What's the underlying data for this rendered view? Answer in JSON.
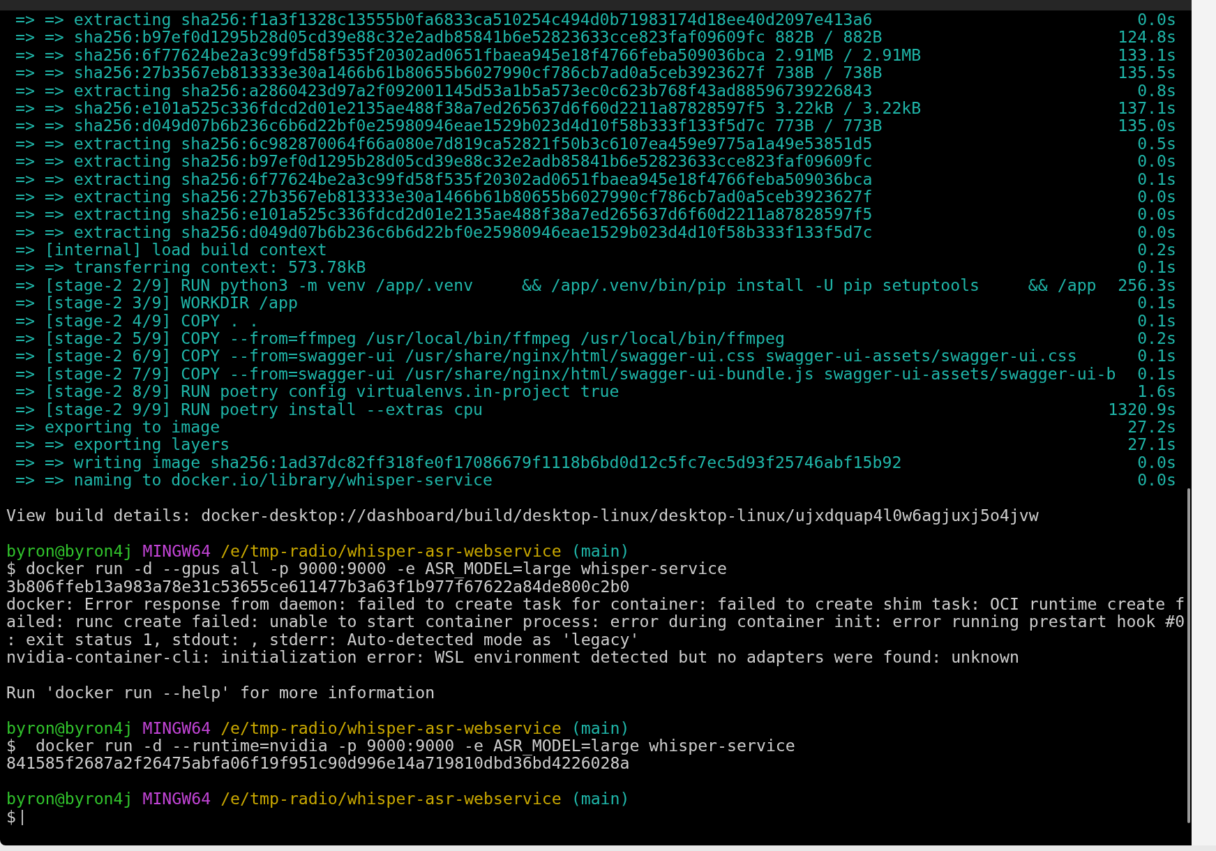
{
  "build_lines": [
    {
      "text": "=> => extracting sha256:f1a3f1328c13555b0fa6833ca510254c494d0b71983174d18ee40d2097e413a6",
      "time": "0.0s"
    },
    {
      "text": "=> => sha256:b97ef0d1295b28d05cd39e88c32e2adb85841b6e52823633cce823faf09609fc 882B / 882B",
      "time": "124.8s"
    },
    {
      "text": "=> => sha256:6f77624be2a3c99fd58f535f20302ad0651fbaea945e18f4766feba509036bca 2.91MB / 2.91MB",
      "time": "133.1s"
    },
    {
      "text": "=> => sha256:27b3567eb813333e30a1466b61b80655b6027990cf786cb7ad0a5ceb3923627f 738B / 738B",
      "time": "135.5s"
    },
    {
      "text": "=> => extracting sha256:a2860423d97a2f092001145d53a1b5a573ec0c623b768f43ad88596739226843",
      "time": "0.8s"
    },
    {
      "text": "=> => sha256:e101a525c336fdcd2d01e2135ae488f38a7ed265637d6f60d2211a87828597f5 3.22kB / 3.22kB",
      "time": "137.1s"
    },
    {
      "text": "=> => sha256:d049d07b6b236c6b6d22bf0e25980946eae1529b023d4d10f58b333f133f5d7c 773B / 773B",
      "time": "135.0s"
    },
    {
      "text": "=> => extracting sha256:6c982870064f66a080e7d819ca52821f50b3c6107ea459e9775a1a49e53851d5",
      "time": "0.5s"
    },
    {
      "text": "=> => extracting sha256:b97ef0d1295b28d05cd39e88c32e2adb85841b6e52823633cce823faf09609fc",
      "time": "0.0s"
    },
    {
      "text": "=> => extracting sha256:6f77624be2a3c99fd58f535f20302ad0651fbaea945e18f4766feba509036bca",
      "time": "0.1s"
    },
    {
      "text": "=> => extracting sha256:27b3567eb813333e30a1466b61b80655b6027990cf786cb7ad0a5ceb3923627f",
      "time": "0.0s"
    },
    {
      "text": "=> => extracting sha256:e101a525c336fdcd2d01e2135ae488f38a7ed265637d6f60d2211a87828597f5",
      "time": "0.0s"
    },
    {
      "text": "=> => extracting sha256:d049d07b6b236c6b6d22bf0e25980946eae1529b023d4d10f58b333f133f5d7c",
      "time": "0.0s"
    },
    {
      "text": "=> [internal] load build context",
      "time": "0.2s"
    },
    {
      "text": "=> => transferring context: 573.78kB",
      "time": "0.1s"
    },
    {
      "text": "=> [stage-2 2/9] RUN python3 -m venv /app/.venv     && /app/.venv/bin/pip install -U pip setuptools     && /app",
      "time": "256.3s"
    },
    {
      "text": "=> [stage-2 3/9] WORKDIR /app",
      "time": "0.1s"
    },
    {
      "text": "=> [stage-2 4/9] COPY . .",
      "time": "0.1s"
    },
    {
      "text": "=> [stage-2 5/9] COPY --from=ffmpeg /usr/local/bin/ffmpeg /usr/local/bin/ffmpeg",
      "time": "0.2s"
    },
    {
      "text": "=> [stage-2 6/9] COPY --from=swagger-ui /usr/share/nginx/html/swagger-ui.css swagger-ui-assets/swagger-ui.css",
      "time": "0.1s"
    },
    {
      "text": "=> [stage-2 7/9] COPY --from=swagger-ui /usr/share/nginx/html/swagger-ui-bundle.js swagger-ui-assets/swagger-ui-b",
      "time": "0.1s"
    },
    {
      "text": "=> [stage-2 8/9] RUN poetry config virtualenvs.in-project true",
      "time": "1.6s"
    },
    {
      "text": "=> [stage-2 9/9] RUN poetry install --extras cpu",
      "time": "1320.9s"
    },
    {
      "text": "=> exporting to image",
      "time": "27.2s"
    },
    {
      "text": "=> => exporting layers",
      "time": "27.1s"
    },
    {
      "text": "=> => writing image sha256:1ad37dc82ff318fe0f17086679f1118b6bd0d12c5fc7ec5d93f25746abf15b92",
      "time": "0.0s"
    },
    {
      "text": "=> => naming to docker.io/library/whisper-service",
      "time": "0.0s"
    }
  ],
  "view_build_details": "View build details: docker-desktop://dashboard/build/desktop-linux/desktop-linux/ujxdquap4l0w6agjuxj5o4jvw",
  "sessions": [
    {
      "prompt": {
        "user_host": "byron@byron4j",
        "system": "MINGW64",
        "path": "/e/tmp-radio/whisper-asr-webservice",
        "branch": "(main)"
      },
      "command": "$ docker run -d --gpus all -p 9000:9000 -e ASR_MODEL=large whisper-service",
      "output": [
        [
          "3b806ffeb13a983a78e31c53655ce611477b3a63f1b977f67622a84de800c2b0",
          "docker: Error response from daemon: failed to create task for container: failed to create shim task: OCI runtime create f",
          "ailed: runc create failed: unable to start container process: error during container init: error running prestart hook #0",
          ": exit status 1, stdout: , stderr: Auto-detected mode as 'legacy'",
          "nvidia-container-cli: initialization error: WSL environment detected but no adapters were found: unknown"
        ],
        [
          "Run 'docker run --help' for more information"
        ]
      ],
      "cursor": false
    },
    {
      "prompt": {
        "user_host": "byron@byron4j",
        "system": "MINGW64",
        "path": "/e/tmp-radio/whisper-asr-webservice",
        "branch": "(main)"
      },
      "command": "$  docker run -d --runtime=nvidia -p 9000:9000 -e ASR_MODEL=large whisper-service",
      "output": [
        [
          "841585f2687a2f26475abfa06f19f951c90d996e14a719810dbd36bd4226028a"
        ]
      ],
      "cursor": false
    },
    {
      "prompt": {
        "user_host": "byron@byron4j",
        "system": "MINGW64",
        "path": "/e/tmp-radio/whisper-asr-webservice",
        "branch": "(main)"
      },
      "command": "$",
      "cursor": true
    }
  ]
}
